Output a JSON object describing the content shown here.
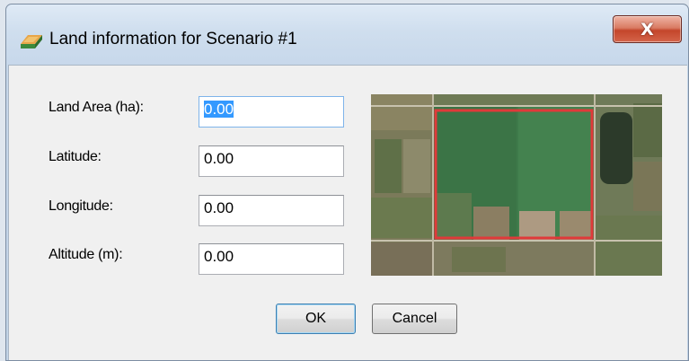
{
  "window": {
    "title": "Land information for Scenario #1",
    "close_label": "X"
  },
  "fields": [
    {
      "label": "Land Area (ha):",
      "value": "0.00",
      "selected": true
    },
    {
      "label": "Latitude:",
      "value": "0.00",
      "selected": false
    },
    {
      "label": "Longitude:",
      "value": "0.00",
      "selected": false
    },
    {
      "label": "Altitude (m):",
      "value": "0.00",
      "selected": false
    }
  ],
  "map": {
    "description_icon": "satellite-map-image",
    "highlight_color": "#e03a3a"
  },
  "buttons": {
    "ok_label": "OK",
    "cancel_label": "Cancel"
  },
  "colors": {
    "selection": "#3399ff",
    "close_button": "#c4462b"
  }
}
